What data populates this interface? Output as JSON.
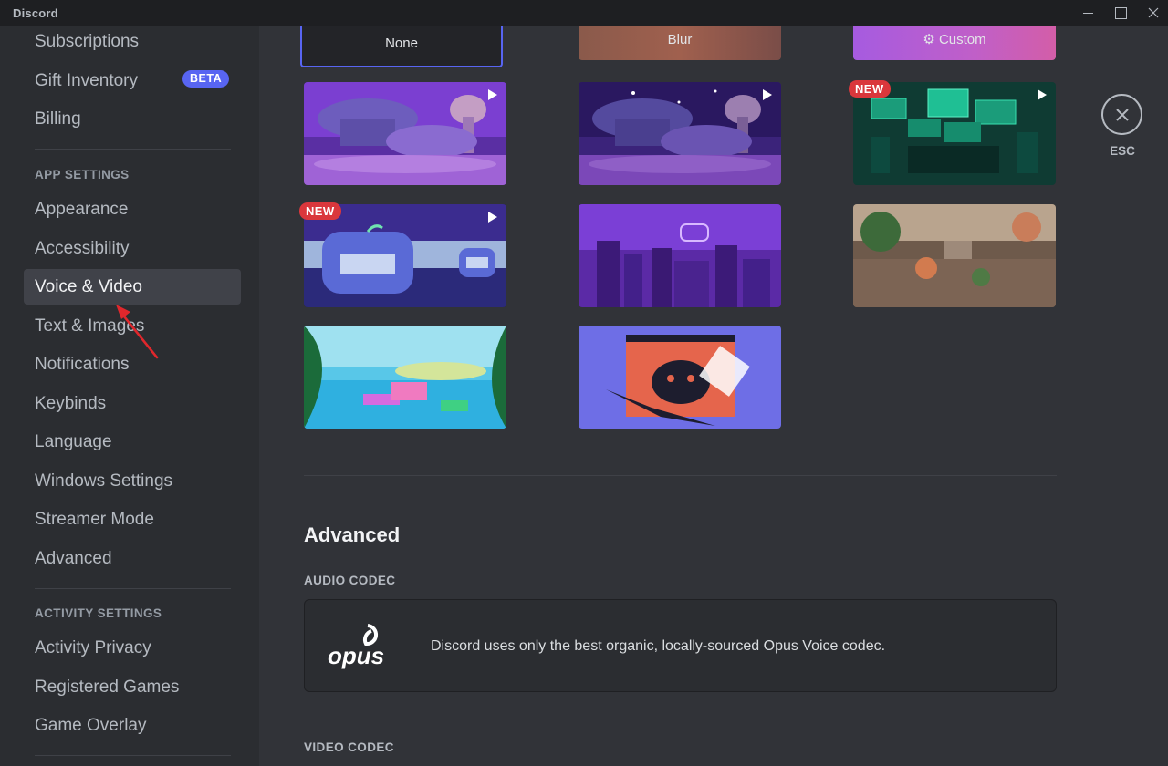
{
  "window": {
    "title": "Discord"
  },
  "sidebar": {
    "top_items": [
      {
        "label": "Subscriptions"
      },
      {
        "label": "Gift Inventory",
        "badge": "BETA"
      },
      {
        "label": "Billing"
      }
    ],
    "app_settings": {
      "header": "APP SETTINGS",
      "items": [
        {
          "label": "Appearance"
        },
        {
          "label": "Accessibility"
        },
        {
          "label": "Voice & Video",
          "selected": true
        },
        {
          "label": "Text & Images"
        },
        {
          "label": "Notifications"
        },
        {
          "label": "Keybinds"
        },
        {
          "label": "Language"
        },
        {
          "label": "Windows Settings"
        },
        {
          "label": "Streamer Mode"
        },
        {
          "label": "Advanced"
        }
      ]
    },
    "activity_settings": {
      "header": "ACTIVITY SETTINGS",
      "items": [
        {
          "label": "Activity Privacy"
        },
        {
          "label": "Registered Games"
        },
        {
          "label": "Game Overlay"
        }
      ]
    }
  },
  "backgrounds": {
    "top_row": [
      {
        "label": "None",
        "selected": true
      },
      {
        "label": "Blur"
      },
      {
        "label": "Custom"
      }
    ],
    "new_badge": "NEW"
  },
  "advanced": {
    "title": "Advanced",
    "audio_codec": {
      "header": "AUDIO CODEC",
      "logo": "opus",
      "description": "Discord uses only the best organic, locally-sourced Opus Voice codec."
    },
    "video_codec": {
      "header": "VIDEO CODEC"
    }
  },
  "esc": {
    "label": "ESC"
  },
  "colors": {
    "accent": "#5865f2",
    "new_badge": "#da373c",
    "selected_outline": "#5865f2",
    "annotation_arrow": "#e0272c"
  }
}
